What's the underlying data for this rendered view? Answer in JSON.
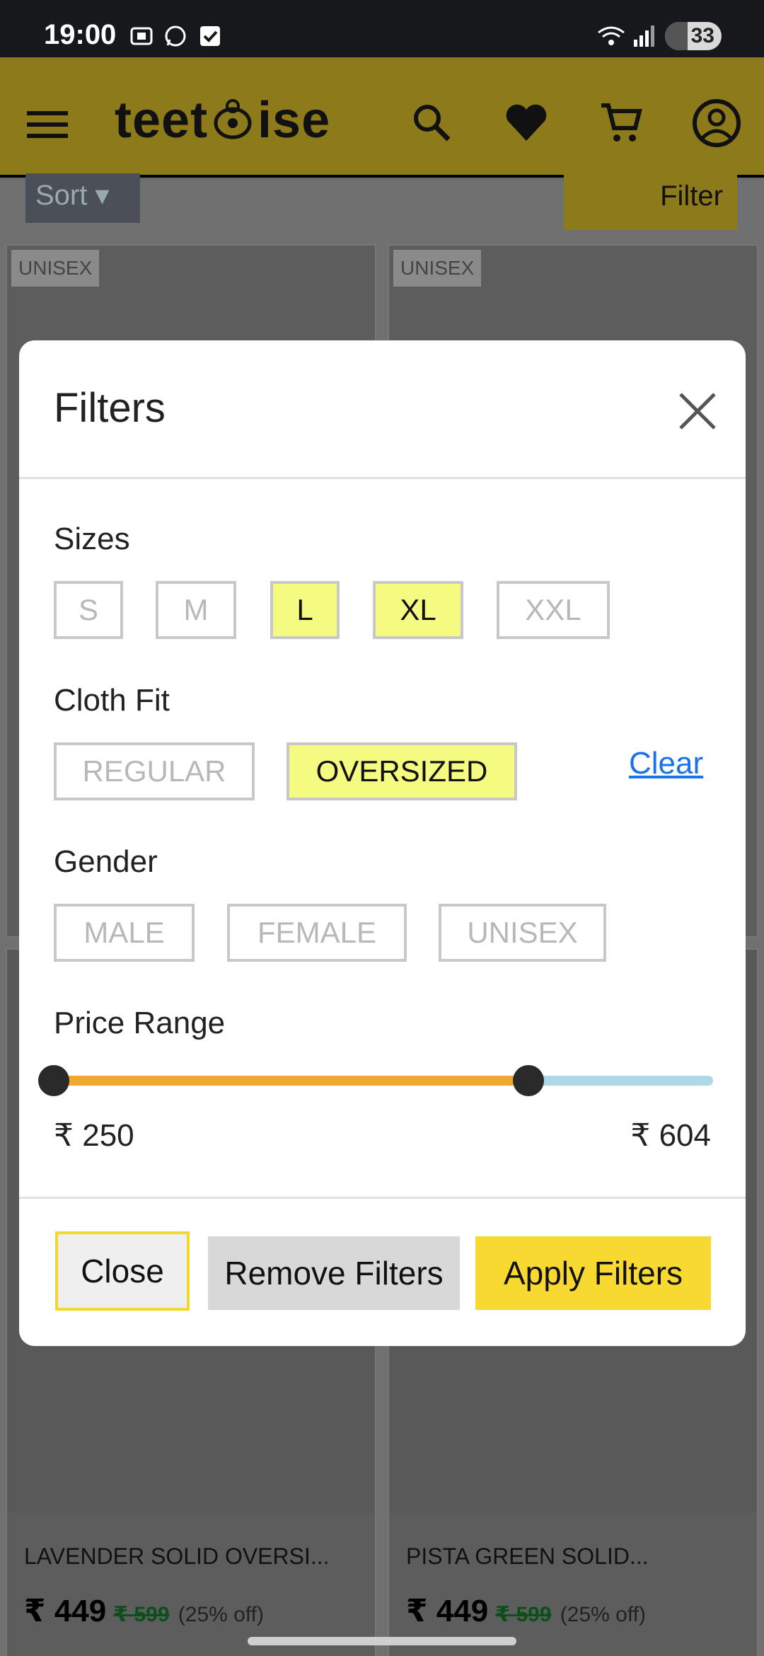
{
  "status_bar": {
    "time": "19:00",
    "battery": "33"
  },
  "header": {
    "logo_left": "teet",
    "logo_right": "ise"
  },
  "page": {
    "sort_label": "Sort",
    "filter_label": "Filter",
    "products": [
      {
        "badge": "UNISEX",
        "title": "LAVENDER SOLID OVERSI...",
        "price": "₹ 449",
        "old_price": "₹ 599",
        "discount": "(25% off)"
      },
      {
        "badge": "UNISEX",
        "title": "PISTA GREEN SOLID...",
        "price": "₹ 449",
        "old_price": "₹ 599",
        "discount": "(25% off)"
      }
    ]
  },
  "modal": {
    "title": "Filters",
    "sizes": {
      "label": "Sizes",
      "options": [
        {
          "label": "S",
          "selected": false
        },
        {
          "label": "M",
          "selected": false
        },
        {
          "label": "L",
          "selected": true
        },
        {
          "label": "XL",
          "selected": true
        },
        {
          "label": "XXL",
          "selected": false
        }
      ]
    },
    "fit": {
      "label": "Cloth Fit",
      "options": [
        {
          "label": "REGULAR",
          "selected": false
        },
        {
          "label": "OVERSIZED",
          "selected": true
        }
      ],
      "clear_label": "Clear"
    },
    "gender": {
      "label": "Gender",
      "options": [
        {
          "label": "MALE",
          "selected": false
        },
        {
          "label": "FEMALE",
          "selected": false
        },
        {
          "label": "UNISEX",
          "selected": false
        }
      ]
    },
    "price_range": {
      "label": "Price Range",
      "min_label": "₹ 250",
      "max_label": "₹ 604",
      "selected_fraction_upper": 0.72
    },
    "buttons": {
      "close": "Close",
      "remove": "Remove Filters",
      "apply": "Apply Filters"
    }
  },
  "colors": {
    "accent_yellow": "#f8d932",
    "selected_chip": "#f4fb80",
    "slider_fill": "#f0a830",
    "slider_track": "#add8e6",
    "link_blue": "#1a73e8"
  }
}
